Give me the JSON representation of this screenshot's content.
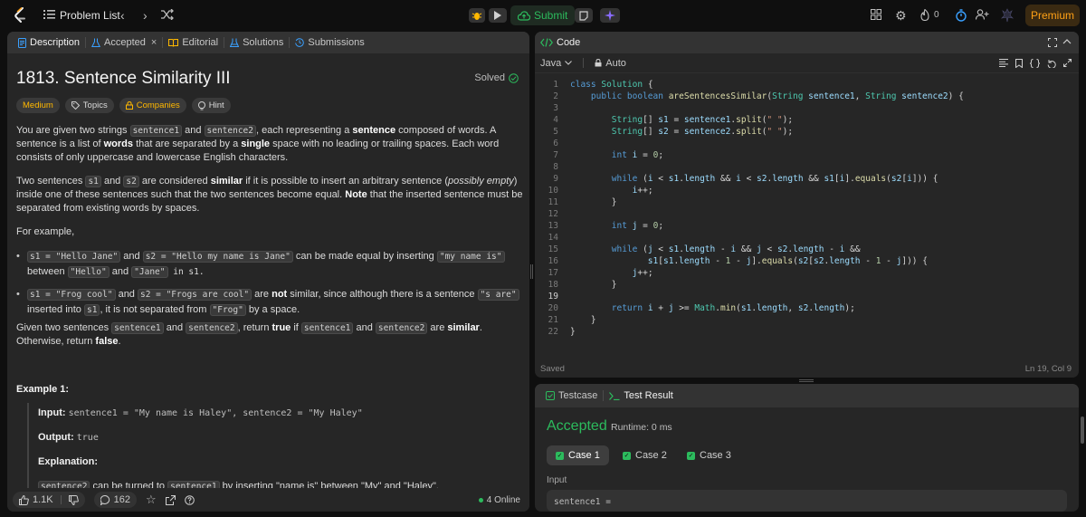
{
  "topbar": {
    "problem_list": "Problem List",
    "submit": "Submit",
    "streak": "0",
    "premium": "Premium"
  },
  "left_tabs": [
    "Description",
    "Accepted",
    "Editorial",
    "Solutions",
    "Submissions"
  ],
  "problem": {
    "title": "1813. Sentence Similarity III",
    "status": "Solved",
    "tags": [
      "Medium",
      "Topics",
      "Companies",
      "Hint"
    ]
  },
  "description": {
    "p1_a": "You are given two strings ",
    "p1_c1": "sentence1",
    "p1_b": " and ",
    "p1_c2": "sentence2",
    "p1_c": ", each representing a ",
    "p1_bold1": "sentence",
    "p1_d": " composed of words. A sentence is a list of ",
    "p1_bold2": "words",
    "p1_e": " that are separated by a ",
    "p1_bold3": "single",
    "p1_f": " space with no leading or trailing spaces. Each word consists of only uppercase and lowercase English characters.",
    "p2_a": "Two sentences ",
    "p2_c1": "s1",
    "p2_b": " and ",
    "p2_c2": "s2",
    "p2_c": " are considered ",
    "p2_bold": "similar",
    "p2_d": " if it is possible to insert an arbitrary sentence (",
    "p2_it": "possibly empty",
    "p2_e": ") inside one of these sentences such that the two sentences become equal. ",
    "p2_bold2": "Note",
    "p2_f": " that the inserted sentence must be separated from existing words by spaces.",
    "p3": "For example,",
    "b1_c1": "s1 = \"Hello Jane\"",
    "b1_a": " and ",
    "b1_c2": "s2 = \"Hello my name is Jane\"",
    "b1_b": " can be made equal by inserting ",
    "b1_c3": "\"my name is\"",
    "b1_c": " between ",
    "b1_c4": "\"Hello\"",
    "b1_d": " and ",
    "b1_c5": "\"Jane\"",
    "b1_e": " in s1.",
    "b2_c1": "s1 = \"Frog cool\"",
    "b2_a": " and ",
    "b2_c2": "s2 = \"Frogs are cool\"",
    "b2_b": " are ",
    "b2_bold": "not",
    "b2_c": " similar, since although there is a sentence ",
    "b2_c3": "\"s are\"",
    "b2_d": " inserted into ",
    "b2_c4": "s1",
    "b2_e": ", it is not separated from ",
    "b2_c5": "\"Frog\"",
    "b2_f": " by a space.",
    "p4_a": "Given two sentences ",
    "p4_c1": "sentence1",
    "p4_b": " and ",
    "p4_c2": "sentence2",
    "p4_c": ", return ",
    "p4_bold1": "true",
    "p4_d": " if ",
    "p4_c3": "sentence1",
    "p4_e": " and ",
    "p4_c4": "sentence2",
    "p4_f": " are ",
    "p4_bold2": "similar",
    "p4_g": ". Otherwise, return ",
    "p4_bold3": "false",
    "p4_h": "."
  },
  "example": {
    "title": "Example 1:",
    "input_label": "Input:",
    "input_value": "sentence1 = \"My name is Haley\", sentence2 = \"My Haley\"",
    "output_label": "Output:",
    "output_value": "true",
    "explanation_label": "Explanation:",
    "explanation_c1": "sentence2",
    "explanation_a": " can be turned to ",
    "explanation_c2": "sentence1",
    "explanation_b": " by inserting \"name is\" between \"My\" and \"Haley\"."
  },
  "left_footer": {
    "likes": "1.1K",
    "comments": "162",
    "online": "4 Online"
  },
  "code_panel": {
    "title": "Code",
    "language": "Java",
    "mode": "Auto",
    "status": "Saved",
    "cursor": "Ln 19, Col 9",
    "line_numbers": [
      "1",
      "2",
      "3",
      "4",
      "5",
      "6",
      "7",
      "8",
      "9",
      "10",
      "11",
      "12",
      "13",
      "14",
      "15",
      "16",
      "17",
      "18",
      "19",
      "20",
      "21",
      "22"
    ]
  },
  "test_panel": {
    "tabs": [
      "Testcase",
      "Test Result"
    ],
    "result": "Accepted",
    "runtime": "Runtime: 0 ms",
    "cases": [
      "Case 1",
      "Case 2",
      "Case 3"
    ],
    "input_label": "Input",
    "input_value": "sentence1 ="
  },
  "colors": {
    "accent_green": "#2cbb5d",
    "accent_orange": "#ffa116",
    "medium": "#ffb800"
  }
}
